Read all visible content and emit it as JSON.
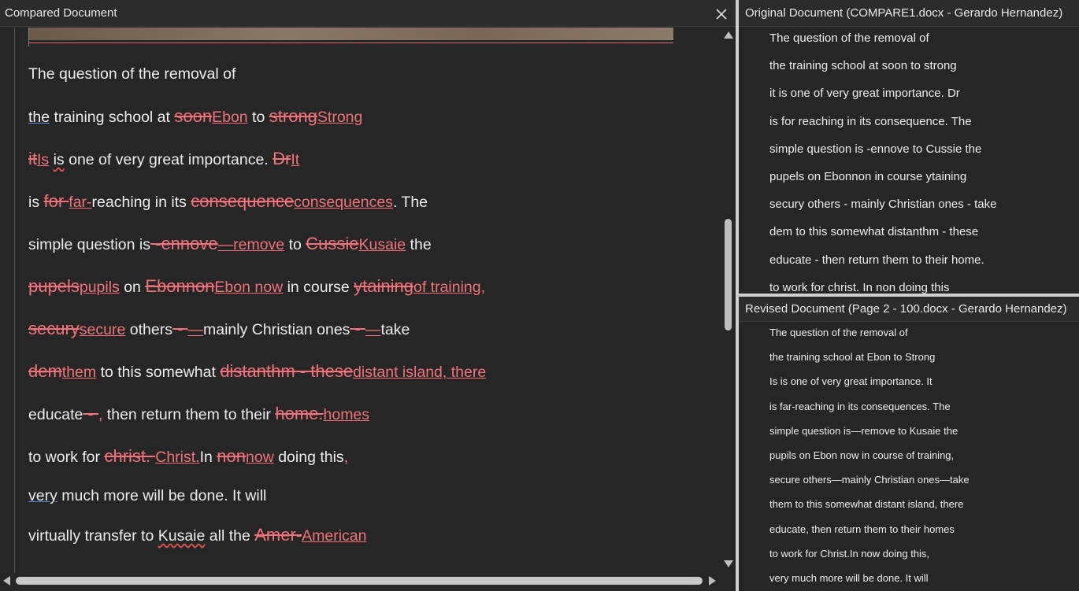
{
  "left_pane": {
    "title": "Compared Document",
    "close_icon": "close-icon",
    "lines": [
      [
        {
          "t": "n",
          "v": "The question of the removal of"
        }
      ],
      [
        {
          "t": "b",
          "v": "the"
        },
        {
          "t": "n",
          "v": " training school at "
        },
        {
          "t": "d",
          "v": "soon"
        },
        {
          "t": "i",
          "v": "Ebon"
        },
        {
          "t": "n",
          "v": " to "
        },
        {
          "t": "d",
          "v": "strong"
        },
        {
          "t": "i",
          "v": "Strong"
        }
      ],
      [
        {
          "t": "d",
          "v": "it"
        },
        {
          "t": "i",
          "v": "Is"
        },
        {
          "t": "n",
          "v": " "
        },
        {
          "t": "s",
          "v": "is"
        },
        {
          "t": "n",
          "v": " one of very great importance. "
        },
        {
          "t": "d",
          "v": "Dr"
        },
        {
          "t": "i",
          "v": "It"
        }
      ],
      [
        {
          "t": "n",
          "v": "is "
        },
        {
          "t": "d",
          "v": "for "
        },
        {
          "t": "i",
          "v": "far-"
        },
        {
          "t": "n",
          "v": "reaching in its "
        },
        {
          "t": "d",
          "v": "consequence"
        },
        {
          "t": "i",
          "v": "consequences"
        },
        {
          "t": "n",
          "v": ". The"
        }
      ],
      [
        {
          "t": "n",
          "v": "simple question is"
        },
        {
          "t": "d",
          "v": " -ennove"
        },
        {
          "t": "i",
          "v": "—remove"
        },
        {
          "t": "n",
          "v": " to "
        },
        {
          "t": "d",
          "v": "Cussie"
        },
        {
          "t": "i",
          "v": "Kusaie"
        },
        {
          "t": "n",
          "v": " the"
        }
      ],
      [
        {
          "t": "d",
          "v": "pupels"
        },
        {
          "t": "i",
          "v": "pupils"
        },
        {
          "t": "n",
          "v": " on "
        },
        {
          "t": "d",
          "v": "Ebonnon"
        },
        {
          "t": "i",
          "v": "Ebon now"
        },
        {
          "t": "n",
          "v": " in course "
        },
        {
          "t": "d",
          "v": "ytaining"
        },
        {
          "t": "i",
          "v": "of training,"
        }
      ],
      [
        {
          "t": "d",
          "v": "secury"
        },
        {
          "t": "i",
          "v": "secure"
        },
        {
          "t": "n",
          "v": " others"
        },
        {
          "t": "d",
          "v": " - "
        },
        {
          "t": "i",
          "v": "—"
        },
        {
          "t": "n",
          "v": "mainly Christian ones"
        },
        {
          "t": "d",
          "v": " - "
        },
        {
          "t": "i",
          "v": "—"
        },
        {
          "t": "n",
          "v": "take"
        }
      ],
      [
        {
          "t": "d",
          "v": "dem"
        },
        {
          "t": "i",
          "v": "them"
        },
        {
          "t": "n",
          "v": " to this somewhat "
        },
        {
          "t": "d",
          "v": "distanthm - these"
        },
        {
          "t": "i",
          "v": "distant island, there"
        }
      ],
      [
        {
          "t": "n",
          "v": "educate"
        },
        {
          "t": "d",
          "v": " - "
        },
        {
          "t": "i",
          "v": ","
        },
        {
          "t": "n",
          "v": " then return them to their "
        },
        {
          "t": "d",
          "v": "home."
        },
        {
          "t": "i",
          "v": "homes"
        }
      ],
      [
        {
          "t": "n",
          "v": "to work for "
        },
        {
          "t": "d",
          "v": "christ. "
        },
        {
          "t": "i",
          "v": "Christ."
        },
        {
          "t": "n",
          "v": "In "
        },
        {
          "t": "d",
          "v": "non"
        },
        {
          "t": "i",
          "v": "now"
        },
        {
          "t": "n",
          "v": " doing this"
        },
        {
          "t": "i",
          "v": ","
        }
      ],
      [
        {
          "t": "b",
          "v": "very"
        },
        {
          "t": "n",
          "v": " much more will be done. It will"
        }
      ],
      [
        {
          "t": "n",
          "v": "virtually transfer to "
        },
        {
          "t": "s",
          "v": "Kusaie"
        },
        {
          "t": "n",
          "v": " all the "
        },
        {
          "t": "d",
          "v": "Amer-"
        },
        {
          "t": "i",
          "v": "American"
        }
      ]
    ]
  },
  "original_pane": {
    "title": "Original Document (COMPARE1.docx - Gerardo Hernandez)",
    "lines": [
      "The question of the removal of",
      "the training school at soon to strong",
      "it is one of very great importance. Dr",
      "is for reaching in its consequence. The",
      "simple question is -ennove to Cussie the",
      "pupels on Ebonnon in course ytaining",
      "secury others - mainly Christian ones - take",
      "dem to this somewhat distanthm - these",
      "educate - then return them to their home.",
      "to work for christ. In non doing this"
    ]
  },
  "revised_pane": {
    "title": "Revised Document (Page 2 - 100.docx - Gerardo Hernandez)",
    "lines": [
      "The question of the removal of",
      "the training school at Ebon to Strong",
      "Is is one of very great importance. It",
      "is far-reaching in its consequences. The",
      "simple question is—remove to Kusaie the",
      "pupils on Ebon now in course of training,",
      "secure others—mainly Christian ones—take",
      "them to this somewhat distant island, there",
      "educate, then return them to their homes",
      "to work for Christ.In now doing this,",
      "very much more will be done. It will"
    ]
  },
  "colors": {
    "deleted": "#f0727a",
    "inserted": "#f0727a",
    "background": "#262626"
  }
}
